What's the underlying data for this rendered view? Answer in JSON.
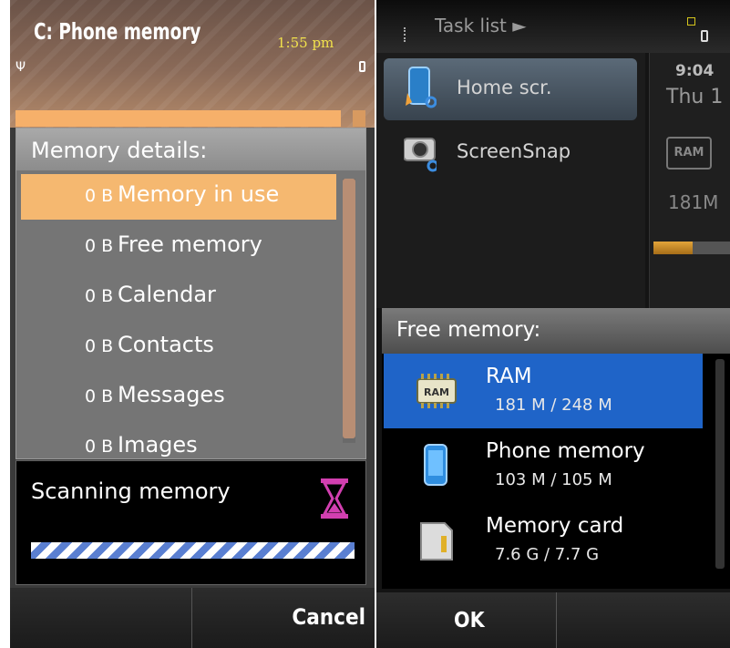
{
  "left": {
    "title": "C: Phone memory",
    "clock": "1:55 pm",
    "dialog_title": "Memory details:",
    "items": [
      {
        "value": "0 B",
        "label": "Memory in use"
      },
      {
        "value": "0 B",
        "label": "Free memory"
      },
      {
        "value": "0 B",
        "label": "Calendar"
      },
      {
        "value": "0 B",
        "label": "Contacts"
      },
      {
        "value": "0 B",
        "label": "Messages"
      },
      {
        "value": "0 B",
        "label": "Images"
      }
    ],
    "scan_label": "Scanning memory",
    "cancel_label": "Cancel"
  },
  "right": {
    "header": "Task list ►",
    "tasks": [
      {
        "label": "Home scr."
      },
      {
        "label": "ScreenSnap"
      }
    ],
    "time": "9:04",
    "date": "Thu 1",
    "ram_chip": "RAM",
    "ram_value": "181M",
    "panel_title": "Free memory:",
    "memory": [
      {
        "name": "RAM",
        "value": "181 M / 248 M",
        "chip": "RAM"
      },
      {
        "name": "Phone memory",
        "value": "103 M / 105 M"
      },
      {
        "name": "Memory card",
        "value": "7.6 G / 7.7 G"
      }
    ],
    "ok_label": "OK"
  }
}
